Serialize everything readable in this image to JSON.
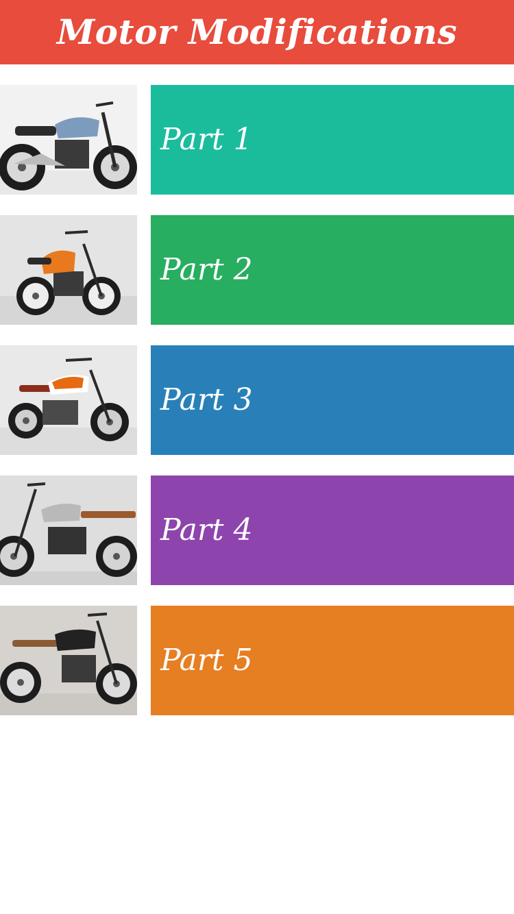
{
  "header": {
    "title": "Motor Modifications",
    "color": "#e74c3c"
  },
  "parts": [
    {
      "label": "Part 1",
      "color": "#1abc9c",
      "image": "motorcycle-blue-tank-photo",
      "photo_bg": "#f2f2f2",
      "tank_color": "#7d9bbd",
      "seat_color": "#2b2b2b"
    },
    {
      "label": "Part 2",
      "color": "#27ae60",
      "image": "motorcycle-orange-tank-photo",
      "photo_bg": "#e4e4e4",
      "tank_color": "#e8791e",
      "seat_color": "#2b2b2b"
    },
    {
      "label": "Part 3",
      "color": "#2980b9",
      "image": "motorcycle-orange-white-tank-photo",
      "photo_bg": "#e9e9e9",
      "tank_color": "#e56a12",
      "seat_color": "#8a2f1c"
    },
    {
      "label": "Part 4",
      "color": "#8e44ad",
      "image": "motorcycle-silver-tank-photo",
      "photo_bg": "#dedede",
      "tank_color": "#b9b9b9",
      "seat_color": "#9a5a2e"
    },
    {
      "label": "Part 5",
      "color": "#e67e22",
      "image": "motorcycle-black-tank-photo",
      "photo_bg": "#d6d3cf",
      "tank_color": "#222222",
      "seat_color": "#8a5a35"
    }
  ]
}
